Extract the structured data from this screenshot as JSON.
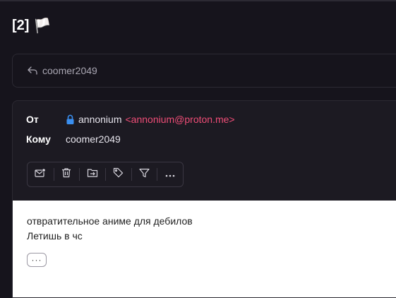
{
  "conversation": {
    "subject": "[2]",
    "subject_emoji": "🏳️"
  },
  "collapsed_message": {
    "icon": "reply-icon",
    "recipient": "coomer2049"
  },
  "message": {
    "from_label": "От",
    "to_label": "Кому",
    "sender_name": "annonium",
    "sender_email": "<annonium@proton.me>",
    "recipient": "coomer2049",
    "lock_color": "#3a8ff0",
    "email_color": "#ef4d77"
  },
  "toolbar": {
    "buttons": [
      "mark-unread-icon",
      "trash-icon",
      "move-to-folder-icon",
      "label-tag-icon",
      "filter-icon",
      "more-options-icon"
    ]
  },
  "body": {
    "line1": "отвратительное аниме для дебилов",
    "line2": "Летишь в чс",
    "more_label": "···"
  }
}
